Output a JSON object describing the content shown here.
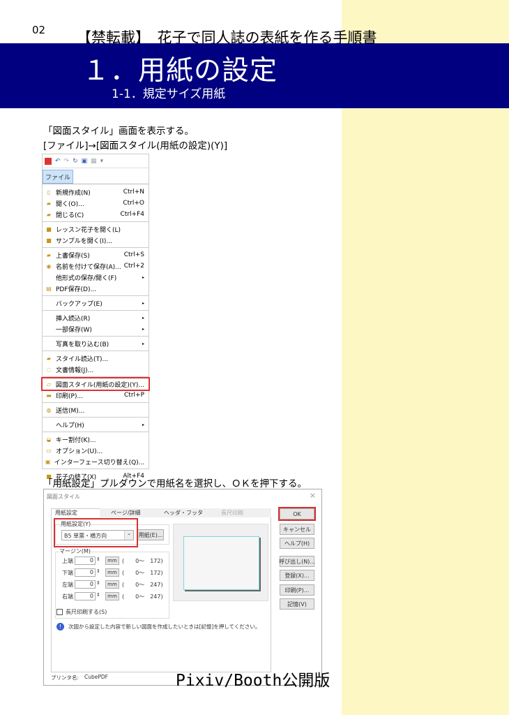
{
  "page": {
    "number": "02",
    "doc_title": "【禁転載】　花子で同人誌の表紙を作る手順書",
    "heading": "１．用紙の設定",
    "subheading": "1-1．規定サイズ用紙",
    "footer": "Pixiv/Booth公開版"
  },
  "steps": {
    "step1_line1": "「図面スタイル」画面を表示する。",
    "step1_line2": "[ファイル]→[図面スタイル(用紙の設定)(Y)]",
    "step2": "「用紙設定」プルダウンで用紙名を選択し、ＯＫを押下する。"
  },
  "menu": {
    "file_tab": "ファイル",
    "groups": [
      [
        {
          "label": "新規作成(N)",
          "shortcut": "Ctrl+N",
          "icon": "new-file"
        },
        {
          "label": "開く(O)...",
          "shortcut": "Ctrl+O",
          "icon": "open-folder"
        },
        {
          "label": "閉じる(C)",
          "shortcut": "Ctrl+F4",
          "icon": "close-folder"
        }
      ],
      [
        {
          "label": "レッスン花子を開く(L)",
          "shortcut": "",
          "icon": "lesson"
        },
        {
          "label": "サンプルを開く(I)...",
          "shortcut": "",
          "icon": "sample"
        }
      ],
      [
        {
          "label": "上書保存(S)",
          "shortcut": "Ctrl+S",
          "icon": "save"
        },
        {
          "label": "名前を付けて保存(A)...",
          "shortcut": "Ctrl+2",
          "icon": "save-as"
        },
        {
          "label": "他形式の保存/開く(F)",
          "shortcut": "",
          "icon": "",
          "submenu": true
        },
        {
          "label": "PDF保存(D)...",
          "shortcut": "",
          "icon": "pdf"
        }
      ],
      [
        {
          "label": "バックアップ(E)",
          "shortcut": "",
          "icon": "",
          "submenu": true
        }
      ],
      [
        {
          "label": "挿入読込(R)",
          "shortcut": "",
          "icon": "",
          "submenu": true
        },
        {
          "label": "一部保存(W)",
          "shortcut": "",
          "icon": "",
          "submenu": true
        }
      ],
      [
        {
          "label": "写真を取り込む(B)",
          "shortcut": "",
          "icon": "",
          "submenu": true
        }
      ],
      [
        {
          "label": "スタイル読込(T)...",
          "shortcut": "",
          "icon": "style-load"
        },
        {
          "label": "文書情報(J)...",
          "shortcut": "",
          "icon": "doc-info"
        }
      ],
      [
        {
          "label": "図面スタイル(用紙の設定)(Y)...",
          "shortcut": "",
          "icon": "page-style",
          "highlight": true
        },
        {
          "label": "印刷(P)...",
          "shortcut": "Ctrl+P",
          "icon": "print"
        }
      ],
      [
        {
          "label": "送信(M)...",
          "shortcut": "",
          "icon": "send"
        }
      ],
      [
        {
          "label": "ヘルプ(H)",
          "shortcut": "",
          "icon": "",
          "submenu": true
        }
      ],
      [
        {
          "label": "キー割付(K)...",
          "shortcut": "",
          "icon": "key"
        },
        {
          "label": "オプション(U)...",
          "shortcut": "",
          "icon": "options"
        },
        {
          "label": "インターフェース切り替え(Q)...",
          "shortcut": "",
          "icon": "interface"
        }
      ],
      [
        {
          "label": "花子の終了(X)",
          "shortcut": "Alt+F4",
          "icon": "exit"
        }
      ]
    ]
  },
  "dialog": {
    "title": "図面スタイル",
    "close": "×",
    "tabs": [
      "用紙設定",
      "ページ/詳細",
      "ヘッダ・フッタ",
      "長尺印刷"
    ],
    "paper_group": "用紙設定(Y)",
    "paper_value": "B5 単票・横方向",
    "paper_button": "用紙(E)...",
    "margin_group": "マージン(M)",
    "unit": "mm",
    "margins": [
      {
        "label": "上端",
        "value": "0",
        "range": "(　　0〜　172)"
      },
      {
        "label": "下端",
        "value": "0",
        "range": "(　　0〜　172)"
      },
      {
        "label": "左端",
        "value": "0",
        "range": "(　　0〜　247)"
      },
      {
        "label": "右端",
        "value": "0",
        "range": "(　　0〜　247)"
      }
    ],
    "long_print": "長尺印刷する(S)",
    "info": "次図から設定した内容で新しい図面を作成したいときは[記憶]を押してください。",
    "printer_label": "プリンタ名:",
    "printer": "CubePDF",
    "buttons": [
      "OK",
      "キャンセル",
      "ヘルプ(H)",
      "呼び出し(N)...",
      "登録(X)...",
      "印刷(P)...",
      "記憶(V)"
    ]
  }
}
